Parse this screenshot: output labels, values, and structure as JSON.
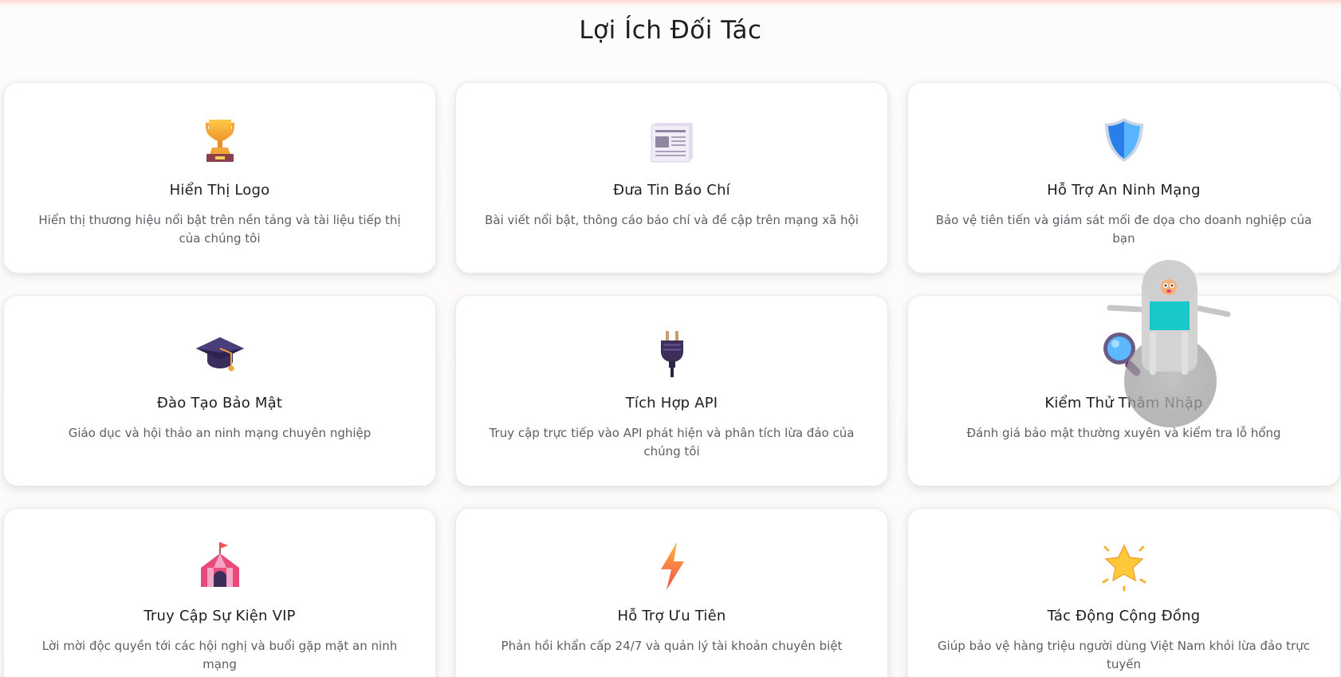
{
  "section": {
    "title": "Lợi Ích Đối Tác"
  },
  "benefits": [
    {
      "title": "Hiển Thị Logo",
      "description": "Hiển thị thương hiệu nổi bật trên nền tảng và tài liệu tiếp thị của chúng tôi",
      "icon": "trophy-icon"
    },
    {
      "title": "Đưa Tin Báo Chí",
      "description": "Bài viết nổi bật, thông cáo báo chí và đề cập trên mạng xã hội",
      "icon": "newspaper-icon"
    },
    {
      "title": "Hỗ Trợ An Ninh Mạng",
      "description": "Bảo vệ tiên tiến và giám sát mối đe dọa cho doanh nghiệp của bạn",
      "icon": "shield-icon"
    },
    {
      "title": "Đào Tạo Bảo Mật",
      "description": "Giáo dục và hội thảo an ninh mạng chuyên nghiệp",
      "icon": "graduation-cap-icon"
    },
    {
      "title": "Tích Hợp API",
      "description": "Truy cập trực tiếp vào API phát hiện và phân tích lừa đảo của chúng tôi",
      "icon": "plug-icon"
    },
    {
      "title": "Kiểm Thử Thâm Nhập",
      "description": "Đánh giá bảo mật thường xuyên và kiểm tra lỗ hổng",
      "icon": "magnifying-glass-icon"
    },
    {
      "title": "Truy Cập Sự Kiện VIP",
      "description": "Lời mời độc quyền tới các hội nghị và buổi gặp mặt an ninh mạng",
      "icon": "circus-tent-icon"
    },
    {
      "title": "Hỗ Trợ Ưu Tiên",
      "description": "Phản hồi khẩn cấp 24/7 và quản lý tài khoản chuyên biệt",
      "icon": "lightning-icon"
    },
    {
      "title": "Tác Động Cộng Đồng",
      "description": "Giúp bảo vệ hàng triệu người dùng Việt Nam khỏi lừa đảo trực tuyến",
      "icon": "glowing-star-icon"
    }
  ],
  "colors": {
    "card_background": "#ffffff",
    "title_text": "#1d1d22",
    "description_text": "#5d5d66",
    "robot_screen": "#19c9c9"
  }
}
